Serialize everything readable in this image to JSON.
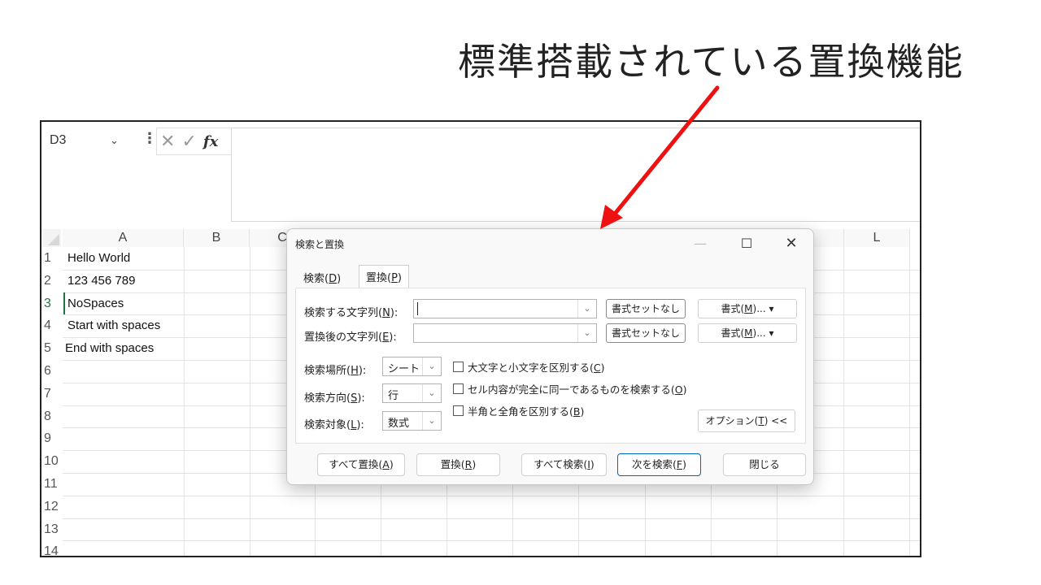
{
  "slide": {
    "title": "標準搭載されている置換機能"
  },
  "excel": {
    "name_box": "D3",
    "fx_label": "fx",
    "formula_value": "",
    "columns": [
      "A",
      "B",
      "C",
      "L"
    ],
    "rows": [
      "1",
      "2",
      "3",
      "4",
      "5",
      "6",
      "7",
      "8",
      "9",
      "10",
      "11",
      "12",
      "13",
      "14"
    ],
    "cells": [
      "Hello World",
      "123 456 789",
      "NoSpaces",
      "Start with spaces",
      "End with spaces"
    ]
  },
  "dialog": {
    "title": "検索と置換",
    "tabs": [
      {
        "label": "検索(",
        "key": "D",
        "end": ")"
      },
      {
        "label": "置換(",
        "key": "P",
        "end": ")"
      }
    ],
    "find_label": {
      "text": "検索する文字列(",
      "key": "N",
      "end": "):"
    },
    "replace_label": {
      "text": "置換後の文字列(",
      "key": "E",
      "end": "):"
    },
    "no_format_button": "書式セットなし",
    "format_button": {
      "text": "書式(",
      "key": "M",
      "end": ")..."
    },
    "within_label": {
      "text": "検索場所(",
      "key": "H",
      "end": "):"
    },
    "within_value": "シート",
    "search_label": {
      "text": "検索方向(",
      "key": "S",
      "end": "):"
    },
    "search_value": "行",
    "lookin_label": {
      "text": "検索対象(",
      "key": "L",
      "end": "):"
    },
    "lookin_value": "数式",
    "options": [
      {
        "text": "大文字と小文字を区別する(",
        "key": "C",
        "end": ")"
      },
      {
        "text": "セル内容が完全に同一であるものを検索する(",
        "key": "O",
        "end": ")"
      },
      {
        "text": "半角と全角を区別する(",
        "key": "B",
        "end": ")"
      }
    ],
    "options_button": {
      "text": "オプション(",
      "key": "T",
      "end": ") <<"
    },
    "bottom_buttons": [
      {
        "text": "すべて置換(",
        "key": "A",
        "end": ")"
      },
      {
        "text": "置換(",
        "key": "R",
        "end": ")"
      },
      {
        "text": "すべて検索(",
        "key": "I",
        "end": ")"
      },
      {
        "text": "次を検索(",
        "key": "F",
        "end": ")"
      },
      {
        "text": "閉じる",
        "key": "",
        "end": ""
      }
    ]
  },
  "colors": {
    "arrow": "#ee1111",
    "accent": "#217346",
    "primary_border": "#0067c0"
  }
}
